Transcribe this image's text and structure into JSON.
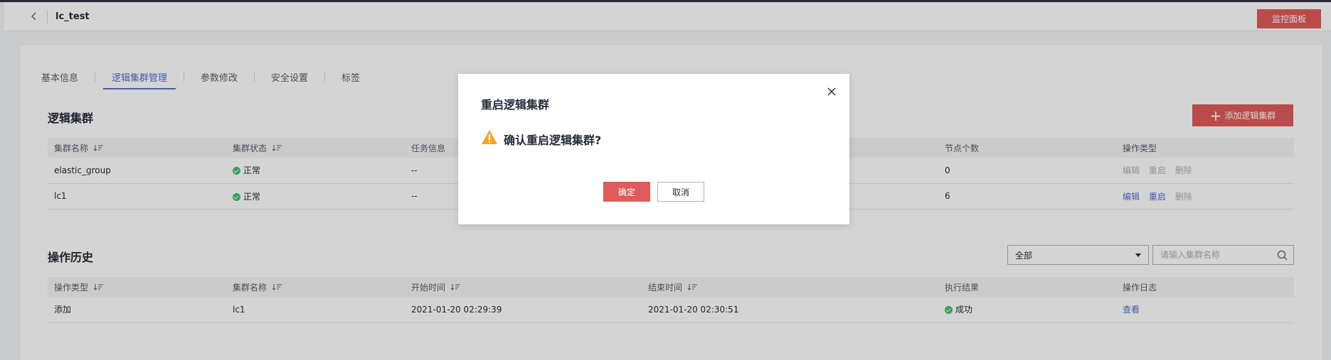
{
  "header": {
    "title": "lc_test",
    "monitor_label": "监控面板"
  },
  "tabs": [
    {
      "label": "基本信息",
      "active": false
    },
    {
      "label": "逻辑集群管理",
      "active": true
    },
    {
      "label": "参数修改",
      "active": false
    },
    {
      "label": "安全设置",
      "active": false
    },
    {
      "label": "标签",
      "active": false
    }
  ],
  "clusters": {
    "section_title": "逻辑集群",
    "add_label": "添加逻辑集群",
    "columns": [
      "集群名称",
      "集群状态",
      "任务信息",
      "节点个数",
      "操作类型"
    ],
    "rows": [
      {
        "name": "elastic_group",
        "status": "正常",
        "task": "--",
        "nodes": "0",
        "ops": {
          "edit": "编辑",
          "restart": "重启",
          "delete": "删除"
        },
        "edit_enabled": false,
        "restart_enabled": false
      },
      {
        "name": "lc1",
        "status": "正常",
        "task": "--",
        "nodes": "6",
        "ops": {
          "edit": "编辑",
          "restart": "重启",
          "delete": "删除"
        },
        "edit_enabled": true,
        "restart_enabled": true
      }
    ]
  },
  "history": {
    "section_title": "操作历史",
    "filter_value": "全部",
    "search_placeholder": "请输入集群名称",
    "columns": [
      "操作类型",
      "集群名称",
      "开始时间",
      "结束时间",
      "执行结果",
      "操作日志"
    ],
    "rows": [
      {
        "op_type": "添加",
        "cluster": "lc1",
        "start": "2021-01-20 02:29:39",
        "end": "2021-01-20 02:30:51",
        "result": "成功",
        "log": "查看"
      }
    ]
  },
  "dialog": {
    "title": "重启逻辑集群",
    "message": "确认重启逻辑集群?",
    "ok_label": "确定",
    "cancel_label": "取消"
  },
  "colors": {
    "accent": "#526ecc",
    "danger": "#e05b5b",
    "success": "#3fbf73",
    "warning": "#f5a623"
  }
}
